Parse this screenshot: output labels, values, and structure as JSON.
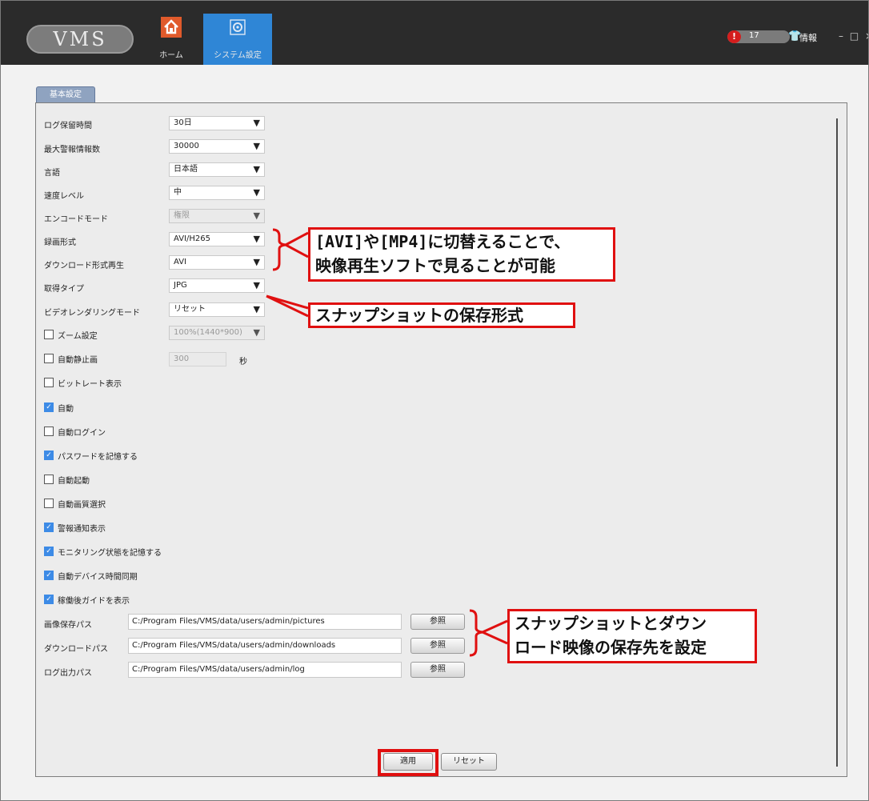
{
  "window": {
    "logo": "VMS",
    "nav": [
      {
        "label": "ホーム",
        "icon": "home-icon"
      },
      {
        "label": "システム設定",
        "icon": "gear-icon"
      }
    ],
    "alarm_count": "17",
    "info_label": "情報",
    "controls": "– □ ×"
  },
  "tab": "基本設定",
  "settings": {
    "log_retention": {
      "label": "ログ保留時間",
      "value": "30日"
    },
    "max_alarms": {
      "label": "最大警報情報数",
      "value": "30000"
    },
    "language": {
      "label": "言語",
      "value": "日本語"
    },
    "speed_level": {
      "label": "速度レベル",
      "value": "中"
    },
    "encode_mode": {
      "label": "エンコードモード",
      "value": "権限"
    },
    "record_format": {
      "label": "録画形式",
      "value": "AVI/H265"
    },
    "download_format": {
      "label": "ダウンロード形式再生",
      "value": "AVI"
    },
    "capture_type": {
      "label": "取得タイプ",
      "value": "JPG"
    },
    "render_mode": {
      "label": "ビデオレンダリングモード",
      "value": "リセット"
    },
    "zoom": {
      "label": "ズーム設定",
      "value": "100%(1440*900)"
    },
    "auto_still": {
      "label": "自動静止画",
      "value": "300",
      "unit": "秒"
    }
  },
  "checkboxes": [
    {
      "label": "ビットレート表示",
      "checked": false
    },
    {
      "label": "自動",
      "checked": true
    },
    {
      "label": "自動ログイン",
      "checked": false
    },
    {
      "label": "パスワードを記憶する",
      "checked": true
    },
    {
      "label": "自動起動",
      "checked": false
    },
    {
      "label": "自動画質選択",
      "checked": false
    },
    {
      "label": "警報通知表示",
      "checked": true
    },
    {
      "label": "モニタリング状態を記憶する",
      "checked": true
    },
    {
      "label": "自動デバイス時間同期",
      "checked": true
    },
    {
      "label": "稼働後ガイドを表示",
      "checked": true
    }
  ],
  "paths": [
    {
      "label": "画像保存パス",
      "value": "C:/Program Files/VMS/data/users/admin/pictures",
      "button": "参照"
    },
    {
      "label": "ダウンロードパス",
      "value": "C:/Program Files/VMS/data/users/admin/downloads",
      "button": "参照"
    },
    {
      "label": "ログ出力パス",
      "value": "C:/Program Files/VMS/data/users/admin/log",
      "button": "参照"
    }
  ],
  "buttons": {
    "apply": "適用",
    "reset": "リセット"
  },
  "callouts": {
    "format_line1": "[AVI]や[MP4]に切替えることで、",
    "format_line2": "映像再生ソフトで見ることが可能",
    "snapshot": "スナップショットの保存形式",
    "path_line1": "スナップショットとダウン",
    "path_line2": "ロード映像の保存先を設定"
  },
  "colors": {
    "accent": "#2f86d6",
    "highlight": "#e01010",
    "alarm": "#d41d1d"
  }
}
